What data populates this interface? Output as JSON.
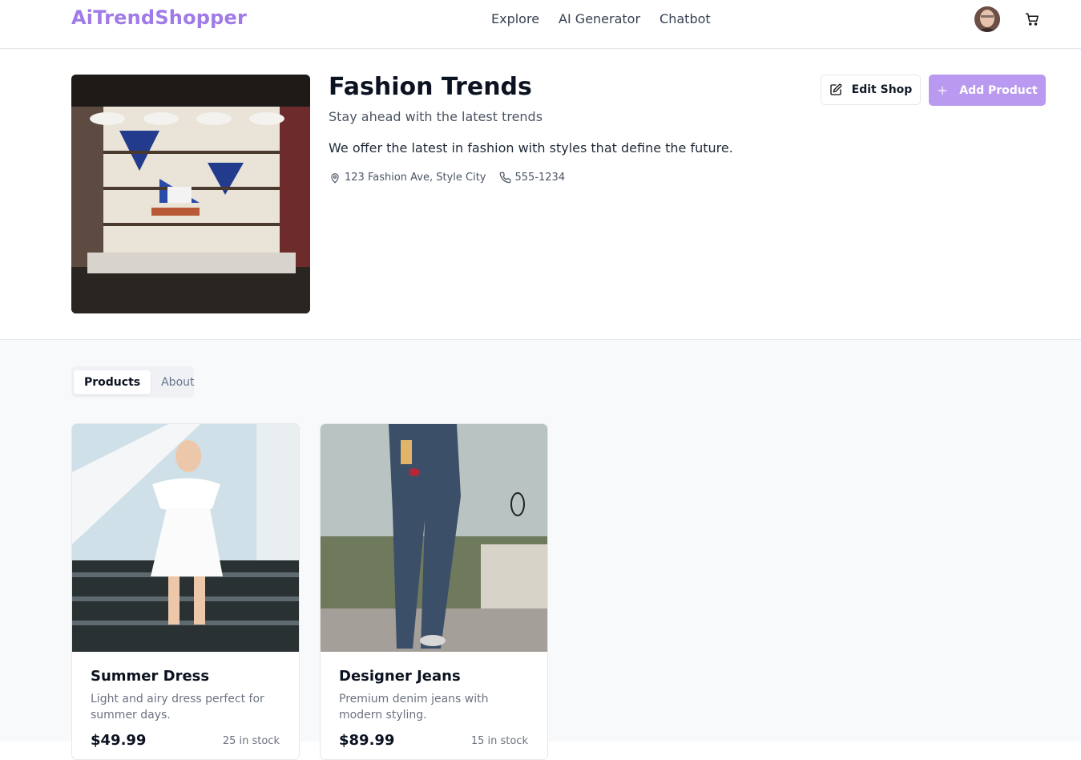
{
  "nav": {
    "brand": "AiTrendShopper",
    "links": [
      "Explore",
      "AI Generator",
      "Chatbot"
    ]
  },
  "shop": {
    "title": "Fashion Trends",
    "subtitle": "Stay ahead with the latest trends",
    "description": "We offer the latest in fashion with styles that define the future.",
    "address": "123 Fashion Ave, Style City",
    "phone": "555-1234",
    "edit_label": "Edit Shop",
    "add_label": "Add Product"
  },
  "tabs": [
    {
      "label": "Products",
      "active": true
    },
    {
      "label": "About",
      "active": false
    }
  ],
  "products": [
    {
      "name": "Summer Dress",
      "description": "Light and airy dress perfect for summer days.",
      "price": "$49.99",
      "stock": "25 in stock"
    },
    {
      "name": "Designer Jeans",
      "description": "Premium denim jeans with modern styling.",
      "price": "$89.99",
      "stock": "15 in stock"
    }
  ],
  "icons": {
    "avatar": "user-avatar",
    "cart": "shopping-cart-icon",
    "location": "map-pin-icon",
    "phone": "phone-icon",
    "edit": "edit-icon",
    "add": "plus-icon"
  },
  "colors": {
    "brand": "#a07be8",
    "primary_button": "#b99af0"
  }
}
